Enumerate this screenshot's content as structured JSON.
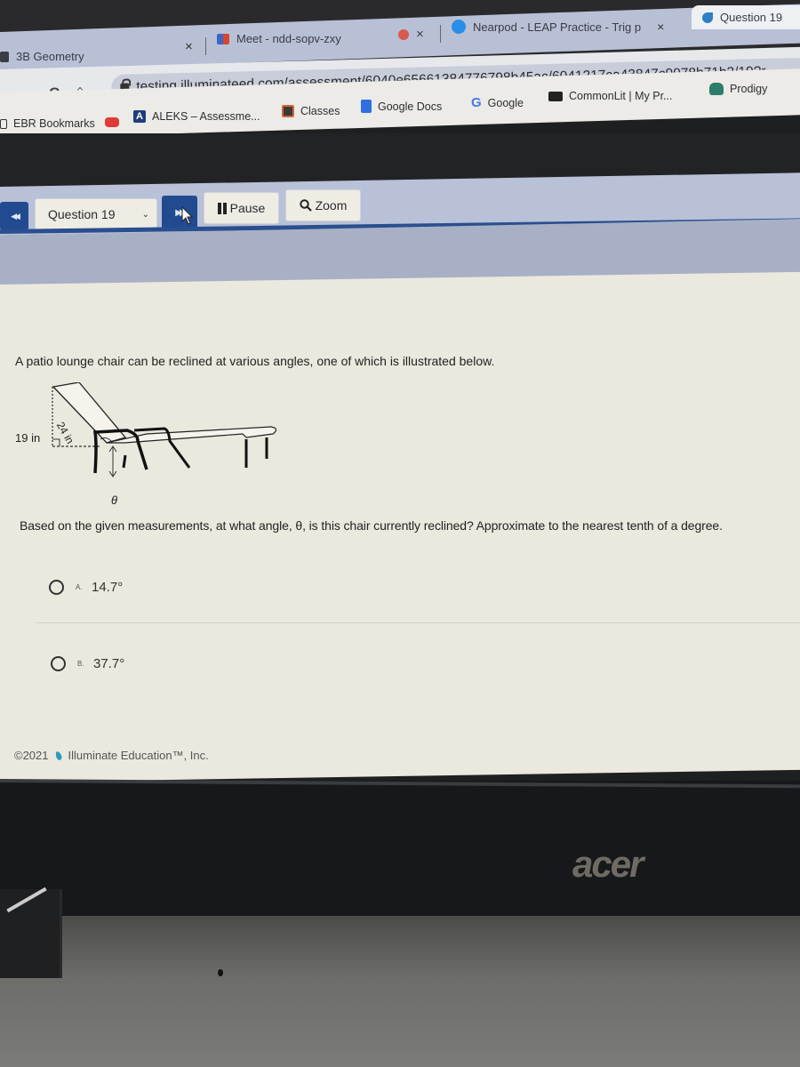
{
  "browser": {
    "tabs": [
      {
        "label": "3B Geometry",
        "icon": "classroom-icon",
        "active": false
      },
      {
        "label": "Meet - ndd-sopv-zxy",
        "icon": "meet-icon",
        "active": false
      },
      {
        "label": "",
        "icon": "record-icon",
        "active": false
      },
      {
        "label": "Nearpod - LEAP Practice - Trig p",
        "icon": "nearpod-icon",
        "active": false
      },
      {
        "label": "Question 19",
        "icon": "illuminate-icon",
        "active": true
      }
    ],
    "close_glyph": "×",
    "nav": {
      "back": "←",
      "forward": "→",
      "reload": "C",
      "home": "⌂"
    },
    "url": "testing.illuminateed.com/assessment/6040e65661384776798b45ac/6041217ca43847c9078b71b3/19?r",
    "bookmarks": [
      {
        "label": "EBR Bookmarks",
        "icon": "folder-icon"
      },
      {
        "label": "",
        "icon": "youtube-icon"
      },
      {
        "label": "ALEKS – Assessme...",
        "icon": "aleks-icon"
      },
      {
        "label": "Classes",
        "icon": "classes-icon"
      },
      {
        "label": "Google Docs",
        "icon": "docs-icon"
      },
      {
        "label": "Google",
        "icon": "google-icon"
      },
      {
        "label": "CommonLit | My Pr...",
        "icon": "commonlit-icon"
      },
      {
        "label": "Prodigy",
        "icon": "prodigy-icon"
      }
    ]
  },
  "toolbar": {
    "prev_glyph": "◀◀",
    "question_select": "Question 19",
    "next_glyph": "▶▶",
    "pause_label": "Pause",
    "zoom_label": "Zoom"
  },
  "question": {
    "stem": "A patio lounge chair can be reclined at various angles, one of which is illustrated below.",
    "figure": {
      "height_label": "19 in",
      "hypotenuse_label": "24 in",
      "angle_label": "θ"
    },
    "prompt": "Based on the given measurements, at what angle, θ, is this chair currently reclined? Approximate to the nearest tenth of a degree.",
    "choices": [
      {
        "letter": "A.",
        "text": "14.7°",
        "selected": false
      },
      {
        "letter": "B.",
        "text": "37.7°",
        "selected": false
      }
    ]
  },
  "footer": {
    "copyright": "©2021",
    "company": "Illuminate Education™, Inc."
  },
  "device": {
    "brand": "acer"
  },
  "colors": {
    "toolbar_blue": "#214a91",
    "toolbar_bg": "#b9c1d8",
    "content_bg": "#ebe8dd",
    "illuminate_teal": "#2c9ac4"
  }
}
